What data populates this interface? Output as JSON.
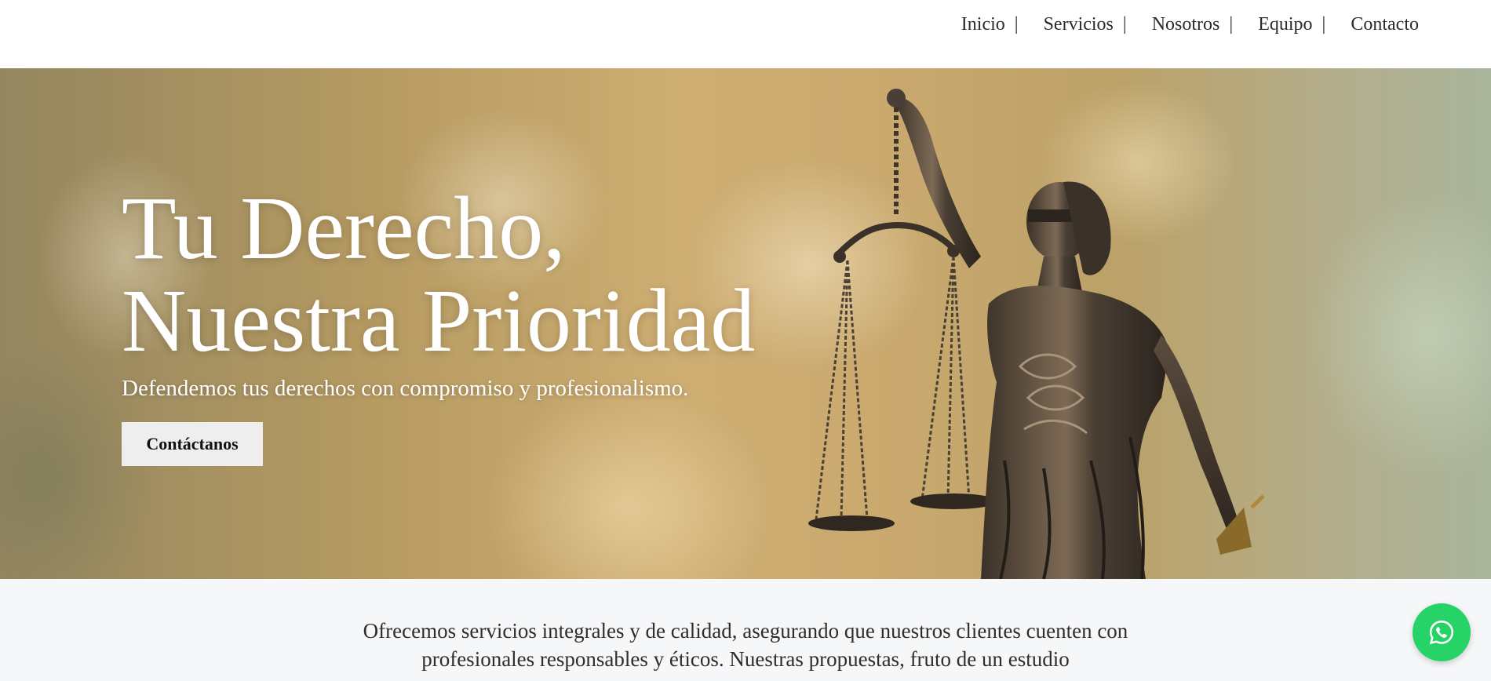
{
  "nav": {
    "items": [
      {
        "label": "Inicio",
        "separator": "|"
      },
      {
        "label": "Servicios",
        "separator": "|"
      },
      {
        "label": "Nosotros",
        "separator": "|"
      },
      {
        "label": "Equipo",
        "separator": "|"
      },
      {
        "label": "Contacto",
        "separator": ""
      }
    ]
  },
  "hero": {
    "title_line1": "Tu Derecho,",
    "title_line2": "Nuestra Prioridad",
    "subtitle": "Defendemos tus derechos con compromiso y profesionalismo.",
    "cta_label": "Contáctanos",
    "image": "lady-justice-statue"
  },
  "intro": {
    "text": "Ofrecemos servicios integrales y de calidad, asegurando que nuestros clientes cuenten con profesionales responsables y éticos. Nuestras propuestas, fruto de un estudio"
  },
  "floating": {
    "icon": "whatsapp-icon",
    "color": "#25d366"
  },
  "colors": {
    "header_bg": "#ffffff",
    "cta_bg": "#eeeeee",
    "hero_text": "#ffffff",
    "section_bg": "#f6f7f9"
  }
}
